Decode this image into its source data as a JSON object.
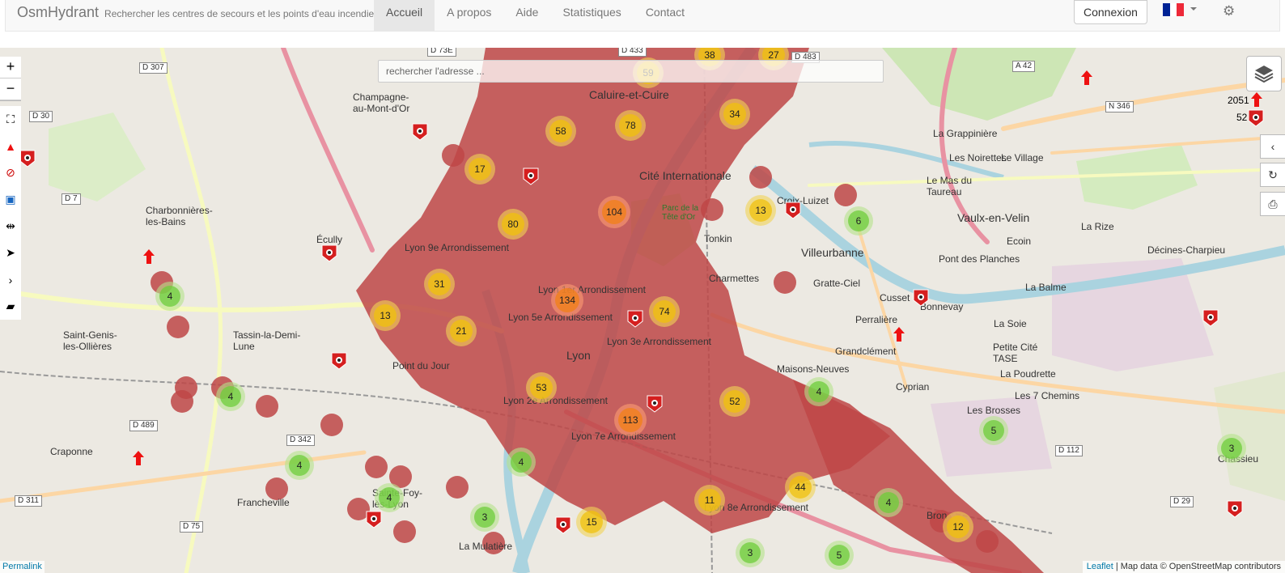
{
  "navbar": {
    "brand": "OsmHydrant",
    "tagline": "Rechercher les centres de secours et les points d'eau incendie",
    "links": [
      "Accueil",
      "A propos",
      "Aide",
      "Statistiques",
      "Contact"
    ],
    "active_link": "Accueil",
    "login_label": "Connexion",
    "language": "fr",
    "flag_colors": [
      "#002395",
      "#ffffff",
      "#ed2939"
    ]
  },
  "search": {
    "placeholder": "rechercher l'adresse ..."
  },
  "map_controls": {
    "zoom_in": "+",
    "zoom_out": "−",
    "tools": [
      "fullscreen-icon",
      "add-hydrant-icon",
      "add-station-icon",
      "rectangle-icon",
      "measure-icon",
      "locate-icon",
      "expand-icon",
      "folder-icon"
    ],
    "right": [
      "layers-icon",
      "collapse-icon",
      "refresh-icon",
      "print-icon"
    ]
  },
  "side_counts": [
    "2051",
    "52"
  ],
  "place_labels": [
    "Caluire-et-Cuire",
    "Cité Internationale",
    "Villeurbanne",
    "Gratte-Ciel",
    "Charmettes",
    "Tonkin",
    "Lyon",
    "Lyon 9e Arrondissement",
    "Lyon 1er Arrondissement",
    "Lyon 5e Arrondissement",
    "Lyon 3e Arrondissement",
    "Lyon 2e Arrondissement",
    "Lyon 7e Arrondissement",
    "Lyon 8e Arrondissement",
    "Écully",
    "Tassin-la-Demi-Lune",
    "Point du Jour",
    "Craponne",
    "Francheville",
    "Sainte-Foy-lès-Lyon",
    "La Mulatière",
    "Champagne-au-Mont-d'Or",
    "Charbonnières-les-Bains",
    "Saint-Genis-les-Ollières",
    "Vaulx-en-Velin",
    "Le Mas du Taureau",
    "Les Noirettes",
    "La Grappinière",
    "Le Village",
    "Décines-Charpieu",
    "La Rize",
    "Pont des Planches",
    "La Balme",
    "Cusset",
    "Bonnevay",
    "Perralière",
    "Grandclément",
    "Maisons-Neuves",
    "Cyprian",
    "Petite Cité TASE",
    "La Poudrette",
    "Les 7 Chemins",
    "Les Brosses",
    "Chassieu",
    "La Soie",
    "Ecoin",
    "Croix-Luizet",
    "Bron",
    "Parc de la Tête d'Or"
  ],
  "road_labels": [
    "D 307",
    "D 30",
    "D 7",
    "D 489",
    "D 342",
    "D 311",
    "D 75",
    "D 112",
    "D 29",
    "A 42",
    "N 346",
    "D 433",
    "D 483",
    "D 73E"
  ],
  "clusters": [
    {
      "count": "38",
      "size": "y"
    },
    {
      "count": "27",
      "size": "y"
    },
    {
      "count": "59",
      "size": "y"
    },
    {
      "count": "58",
      "size": "y"
    },
    {
      "count": "78",
      "size": "y"
    },
    {
      "count": "34",
      "size": "y"
    },
    {
      "count": "17",
      "size": "y"
    },
    {
      "count": "104",
      "size": "o"
    },
    {
      "count": "13",
      "size": "y"
    },
    {
      "count": "6",
      "size": "g"
    },
    {
      "count": "80",
      "size": "y"
    },
    {
      "count": "31",
      "size": "y"
    },
    {
      "count": "134",
      "size": "o"
    },
    {
      "count": "74",
      "size": "y"
    },
    {
      "count": "4",
      "size": "g"
    },
    {
      "count": "13",
      "size": "y"
    },
    {
      "count": "21",
      "size": "y"
    },
    {
      "count": "53",
      "size": "y"
    },
    {
      "count": "52",
      "size": "y"
    },
    {
      "count": "4",
      "size": "g"
    },
    {
      "count": "113",
      "size": "o"
    },
    {
      "count": "4",
      "size": "g"
    },
    {
      "count": "5",
      "size": "g"
    },
    {
      "count": "3",
      "size": "g"
    },
    {
      "count": "4",
      "size": "g"
    },
    {
      "count": "44",
      "size": "y"
    },
    {
      "count": "4",
      "size": "g"
    },
    {
      "count": "4",
      "size": "g"
    },
    {
      "count": "11",
      "size": "y"
    },
    {
      "count": "3",
      "size": "g"
    },
    {
      "count": "15",
      "size": "y"
    },
    {
      "count": "12",
      "size": "y"
    },
    {
      "count": "3",
      "size": "g"
    },
    {
      "count": "5",
      "size": "g"
    },
    {
      "count": "4",
      "size": "g"
    }
  ],
  "attribution": {
    "leaflet": "Leaflet",
    "rest": "| Map data © OpenStreetMap contributors"
  },
  "permalink": "Permalink"
}
